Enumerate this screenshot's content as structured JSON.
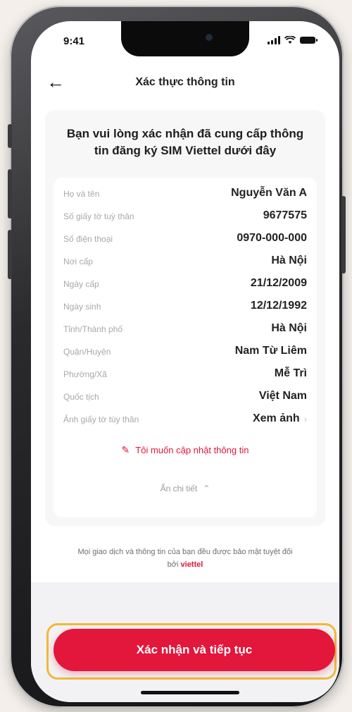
{
  "status_bar": {
    "time": "9:41"
  },
  "header": {
    "back_icon": "arrow-left-icon",
    "title": "Xác thực thông tin"
  },
  "prompt": "Bạn vui lòng xác nhận đã cung cấp thông tin đăng ký SIM Viettel dưới đây",
  "details": [
    {
      "label": "Họ và tên",
      "value": "Nguyễn Văn A"
    },
    {
      "label": "Số giấy tờ tuỳ thân",
      "value": "9677575"
    },
    {
      "label": "Số điện thoại",
      "value": "0970-000-000"
    },
    {
      "label": "Nơi cấp",
      "value": "Hà Nội"
    },
    {
      "label": "Ngày cấp",
      "value": "21/12/2009"
    },
    {
      "label": "Ngày sinh",
      "value": "12/12/1992"
    },
    {
      "label": "Tỉnh/Thành phố",
      "value": "Hà Nội"
    },
    {
      "label": "Quận/Huyện",
      "value": "Nam Từ Liêm"
    },
    {
      "label": "Phường/Xã",
      "value": "Mễ Trì"
    },
    {
      "label": "Quốc tịch",
      "value": "Việt Nam"
    },
    {
      "label": "Ảnh giấy tờ tùy thân",
      "value": "Xem ảnh"
    }
  ],
  "update_link": "Tôi muốn cập nhật thông tin",
  "collapse_label": "Ẩn chi tiết",
  "secure_note": "Mọi giao dịch và thông tin của bạn đều được bảo mật tuyệt đối bởi",
  "brand": "viettel",
  "primary_button": "Xác nhận và tiếp tục",
  "colors": {
    "accent": "#e3163b",
    "highlight": "#f0b93c"
  }
}
